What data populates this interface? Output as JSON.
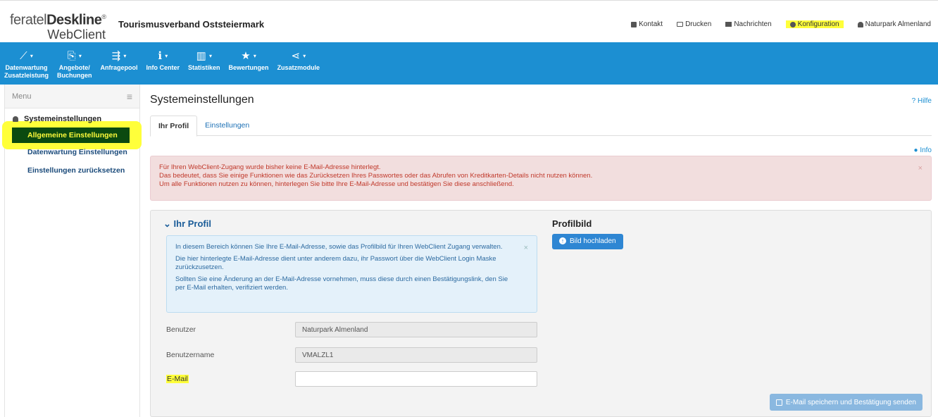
{
  "header": {
    "logo_line1_a": "feratel",
    "logo_line1_b": "Deskline",
    "logo_reg": "®",
    "logo_line2": "WebClient",
    "org": "Tourismusverband Oststeiermark",
    "links": [
      {
        "label": "Kontakt",
        "icon": "contact-icon"
      },
      {
        "label": "Drucken",
        "icon": "print-icon"
      },
      {
        "label": "Nachrichten",
        "icon": "mail-icon"
      },
      {
        "label": "Konfiguration",
        "icon": "gear-icon"
      },
      {
        "label": "Naturpark Almenland",
        "icon": "user-icon"
      }
    ]
  },
  "nav": [
    {
      "icon": "⟋",
      "label1": "Datenwartung",
      "label2": "Zusatzleistung"
    },
    {
      "icon": "⎘",
      "label1": "Angebote/",
      "label2": "Buchungen"
    },
    {
      "icon": "⇶",
      "label1": "Anfragepool",
      "label2": ""
    },
    {
      "icon": "ℹ",
      "label1": "Info Center",
      "label2": ""
    },
    {
      "icon": "▥",
      "label1": "Statistiken",
      "label2": ""
    },
    {
      "icon": "★",
      "label1": "Bewertungen",
      "label2": ""
    },
    {
      "icon": "⋖",
      "label1": "Zusatzmodule",
      "label2": ""
    }
  ],
  "sidebar": {
    "menu_label": "Menu",
    "section": "Systemeinstellungen",
    "items": [
      "Allgemeine Einstellungen",
      "Datenwartung Einstellungen",
      "Einstellungen zurücksetzen"
    ]
  },
  "main": {
    "title": "Systemeinstellungen",
    "help": "? Hilfe",
    "tabs": [
      "Ihr Profil",
      "Einstellungen"
    ],
    "info": "Info",
    "alert_lines": [
      "Für Ihren WebClient-Zugang wurde bisher keine E-Mail-Adresse hinterlegt.",
      "Das bedeutet, dass Sie einige Funktionen wie das Zurücksetzen Ihres Passwortes oder das Abrufen von Kreditkarten-Details nicht nutzen können.",
      "Um alle Funktionen nutzen zu können, hinterlegen Sie bitte Ihre E-Mail-Adresse und bestätigen Sie diese anschließend."
    ],
    "panel_title": "Ihr Profil",
    "info_paragraphs": [
      "In diesem Bereich können Sie Ihre E-Mail-Adresse, sowie das Profilbild für Ihren WebClient Zugang verwalten.",
      "Die hier hinterlegte E-Mail-Adresse dient unter anderem dazu, ihr Passwort über die WebClient Login Maske zurückzusetzen.",
      "Sollten Sie eine Änderung an der E-Mail-Adresse vornehmen, muss diese durch einen Bestätigungslink, den Sie per E-Mail erhalten, verifiziert werden."
    ],
    "fields": [
      {
        "label": "Benutzer",
        "value": "Naturpark Almenland"
      },
      {
        "label": "Benutzername",
        "value": "VMALZL1"
      },
      {
        "label": "E-Mail",
        "value": ""
      }
    ],
    "profilbild_title": "Profilbild",
    "upload_label": "Bild hochladen",
    "save_label": "E-Mail speichern und Bestätigung senden"
  },
  "colors": {
    "nav_blue": "#1c8fd2",
    "highlight": "#ffff3a",
    "active_item": "#0b4a10"
  }
}
